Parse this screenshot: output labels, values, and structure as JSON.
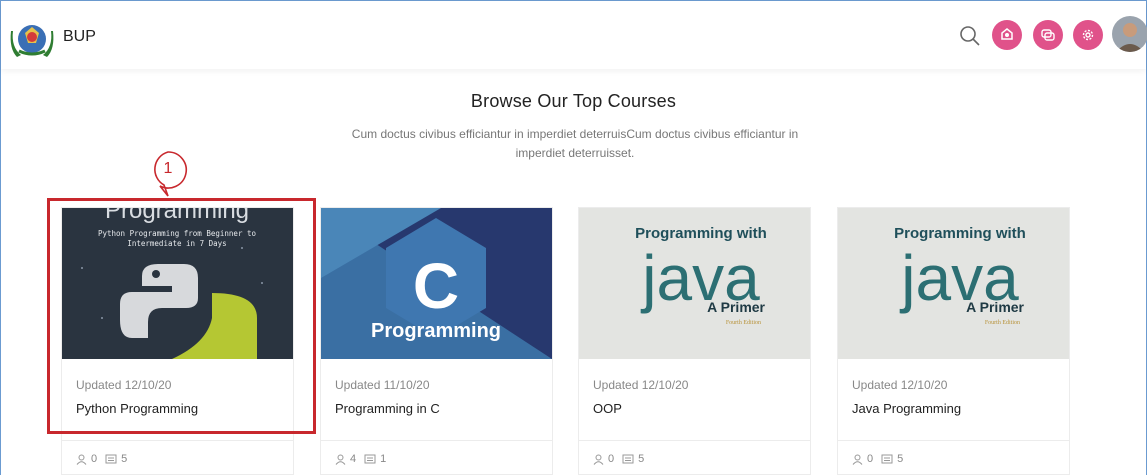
{
  "header": {
    "brand": "BUP",
    "icons": [
      "search-icon",
      "notification-icon",
      "chat-icon",
      "settings-icon"
    ],
    "accent": "#e0528a"
  },
  "section": {
    "title": "Browse Our Top Courses",
    "subtitle": "Cum doctus civibus efficiantur in imperdiet deterruisCum doctus civibus efficiantur in imperdiet deterruisset."
  },
  "annotation": {
    "number": "1",
    "color": "#c8282d"
  },
  "courses": [
    {
      "thumb_text": [
        "Programming",
        "Python Programming from Beginner to",
        "Intermediate in 7 Days"
      ],
      "updated": "Updated 12/10/20",
      "title": "Python Programming",
      "students": "0",
      "lessons": "5"
    },
    {
      "thumb_text": [
        "C",
        "Programming"
      ],
      "updated": "Updated 11/10/20",
      "title": "Programming in C",
      "students": "4",
      "lessons": "1"
    },
    {
      "thumb_text": [
        "Programming with",
        "java",
        "A Primer",
        "Fourth Edition"
      ],
      "updated": "Updated 12/10/20",
      "title": "OOP",
      "students": "0",
      "lessons": "5"
    },
    {
      "thumb_text": [
        "Programming with",
        "java",
        "A Primer",
        "Fourth Edition"
      ],
      "updated": "Updated 12/10/20",
      "title": "Java Programming",
      "students": "0",
      "lessons": "5"
    }
  ]
}
